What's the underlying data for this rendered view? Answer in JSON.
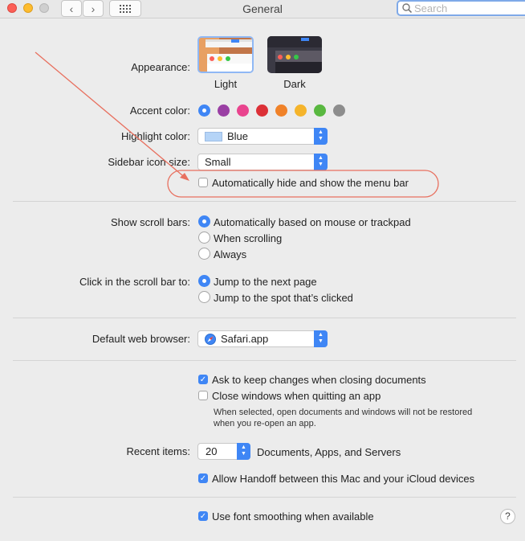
{
  "window": {
    "title": "General"
  },
  "search": {
    "placeholder": "Search"
  },
  "appearance": {
    "label": "Appearance:",
    "options": [
      {
        "label": "Light",
        "selected": true
      },
      {
        "label": "Dark",
        "selected": false
      }
    ]
  },
  "accent": {
    "label": "Accent color:",
    "colors": [
      "#3f86f5",
      "#9a3fa4",
      "#e9448e",
      "#dc3037",
      "#f08229",
      "#f5b42b",
      "#59b840",
      "#8d8d8d"
    ],
    "selected_index": 0
  },
  "highlight": {
    "label": "Highlight color:",
    "value": "Blue",
    "swatch": "#b5d4f7"
  },
  "sidebar_icon": {
    "label": "Sidebar icon size:",
    "value": "Small"
  },
  "menu_bar": {
    "label": "Automatically hide and show the menu bar",
    "checked": false
  },
  "scroll_bars": {
    "label": "Show scroll bars:",
    "options": [
      "Automatically based on mouse or trackpad",
      "When scrolling",
      "Always"
    ],
    "selected_index": 0
  },
  "click_scroll": {
    "label": "Click in the scroll bar to:",
    "options": [
      "Jump to the next page",
      "Jump to the spot that’s clicked"
    ],
    "selected_index": 0
  },
  "browser": {
    "label": "Default web browser:",
    "value": "Safari.app"
  },
  "documents": {
    "ask_keep": {
      "label": "Ask to keep changes when closing documents",
      "checked": true
    },
    "close_windows": {
      "label": "Close windows when quitting an app",
      "checked": false
    },
    "note_line1": "When selected, open documents and windows will not be restored",
    "note_line2": "when you re-open an app."
  },
  "recent": {
    "label": "Recent items:",
    "value": "20",
    "suffix": "Documents, Apps, and Servers"
  },
  "handoff": {
    "label": "Allow Handoff between this Mac and your iCloud devices",
    "checked": true
  },
  "smoothing": {
    "label": "Use font smoothing when available",
    "checked": true
  },
  "help": {
    "label": "?"
  },
  "colors": {
    "accent": "#3f86f5",
    "annotation": "#e8705f"
  }
}
